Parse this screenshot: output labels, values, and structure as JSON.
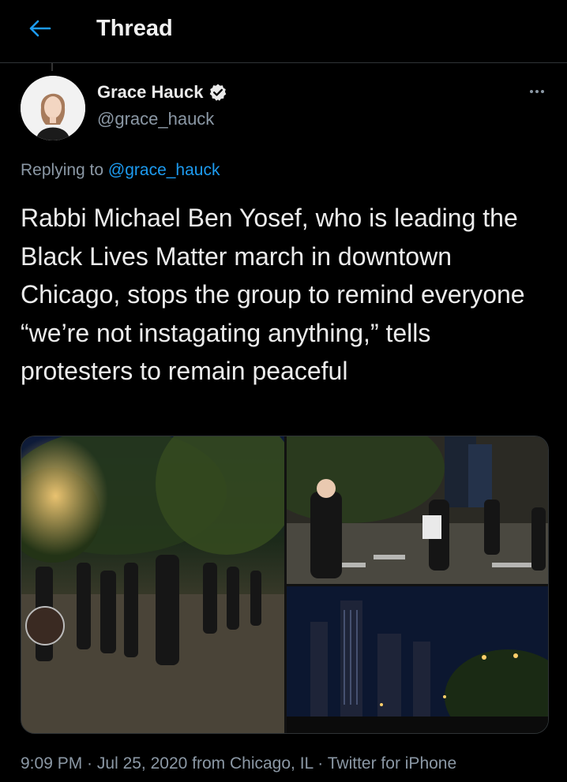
{
  "header": {
    "title": "Thread",
    "back_icon": "arrow-left-icon",
    "accent": "#1d9bf0"
  },
  "tweet": {
    "author_name": "Grace Hauck",
    "author_handle": "@grace_hauck",
    "verified": true,
    "replying_prefix": "Replying to",
    "replying_handle": "@grace_hauck",
    "text": "Rabbi Michael Ben Yosef, who is leading the Black Lives Matter march in downtown Chicago, stops the group to remind everyone “we’re not instagating anything,” tells protesters to remain peaceful",
    "meta": {
      "time": "9:09 PM",
      "sep1": " · ",
      "date": "Jul 25, 2020",
      "location": " from Chicago, IL",
      "sep2": " · ",
      "client": "Twitter for iPhone"
    }
  },
  "colors": {
    "background": "#000000",
    "text": "#ececec",
    "muted": "#8b98a5",
    "link": "#1d9bf0",
    "divider": "#2f3336"
  }
}
